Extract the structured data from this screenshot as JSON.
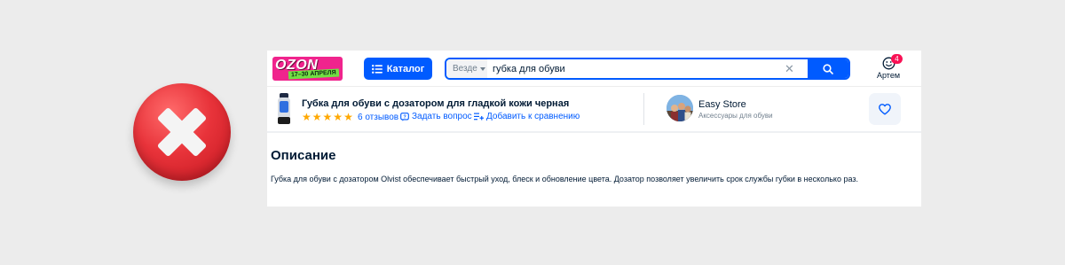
{
  "header": {
    "logo": {
      "word": "OZON",
      "dates": "17–30 АПРЕЛЯ"
    },
    "catalog_label": "Каталог",
    "search": {
      "scope": "Везде",
      "query": "губка для обуви"
    },
    "user": {
      "label": "Артем",
      "badge_count": "4"
    }
  },
  "product": {
    "title": "Губка для обуви с дозатором для гладкой кожи черная",
    "rating_stars": 5,
    "reviews": "6 отзывов",
    "ask_question": "Задать вопрос",
    "add_compare": "Добавить к сравнению"
  },
  "store": {
    "name": "Easy Store",
    "subtitle": "Аксессуары для обуви"
  },
  "description": {
    "title": "Описание",
    "text": "Губка для обуви с дозатором Olvist обеспечивает быстрый уход, блеск и обновление цвета. Дозатор позволяет увеличить срок службы губки в несколько раз."
  },
  "colors": {
    "brand_blue": "#005bff",
    "badge_red": "#f91155",
    "star": "#ffa800",
    "x_badge": "#e8333a"
  },
  "icons": [
    "x-mark-icon",
    "menu-lines-icon",
    "chevron-down-icon",
    "close-icon",
    "search-icon",
    "smile-user-icon",
    "star-icon",
    "question-bubble-icon",
    "compare-list-icon",
    "heart-icon"
  ]
}
